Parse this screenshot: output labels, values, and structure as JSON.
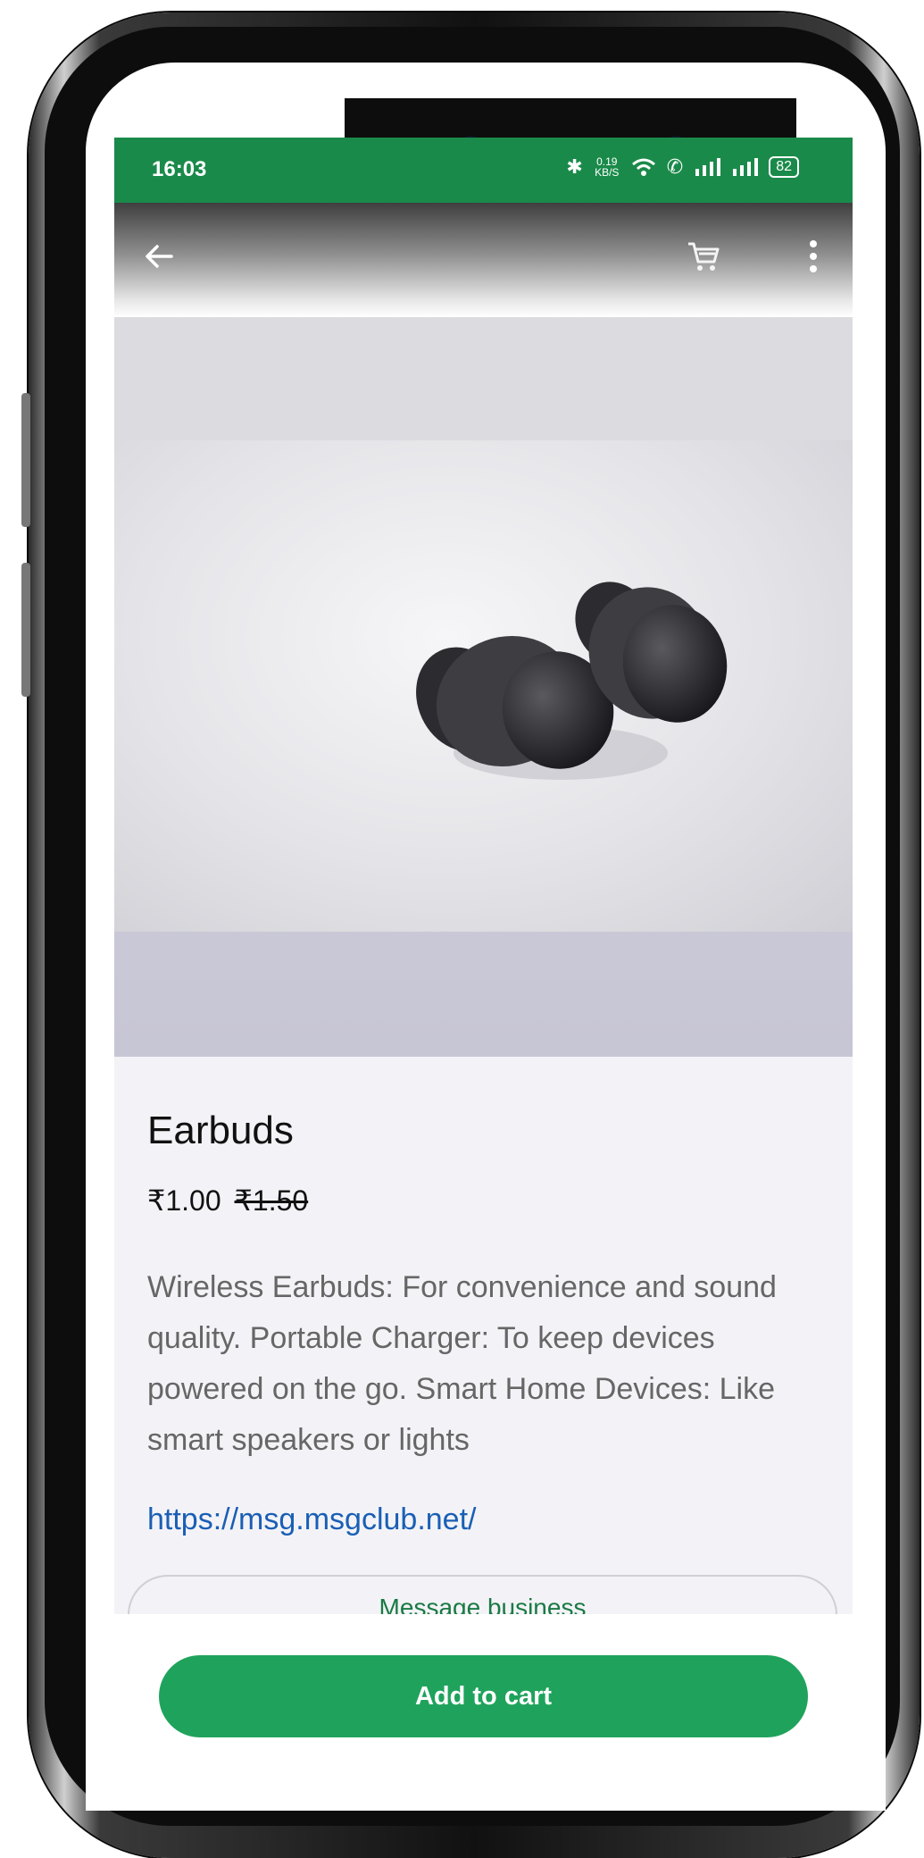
{
  "status_bar": {
    "time": "16:03",
    "net_speed": "0.19 KB/S",
    "battery": "82"
  },
  "toolbar": {
    "back_icon": "arrow-left-icon",
    "cart_icon": "cart-icon",
    "menu_icon": "more-vert-icon"
  },
  "product": {
    "title": "Earbuds",
    "price": "₹1.00",
    "original_price": "₹1.50",
    "description": "Wireless Earbuds: For convenience and sound quality. Portable Charger: To keep devices powered on the go. Smart Home Devices: Like smart speakers or lights",
    "link": "https://msg.msgclub.net/"
  },
  "actions": {
    "message_business": "Message business",
    "add_to_cart": "Add to cart"
  },
  "colors": {
    "status_bar": "#1a8a4a",
    "primary_button": "#1fa35c",
    "link": "#1a5fb4"
  }
}
